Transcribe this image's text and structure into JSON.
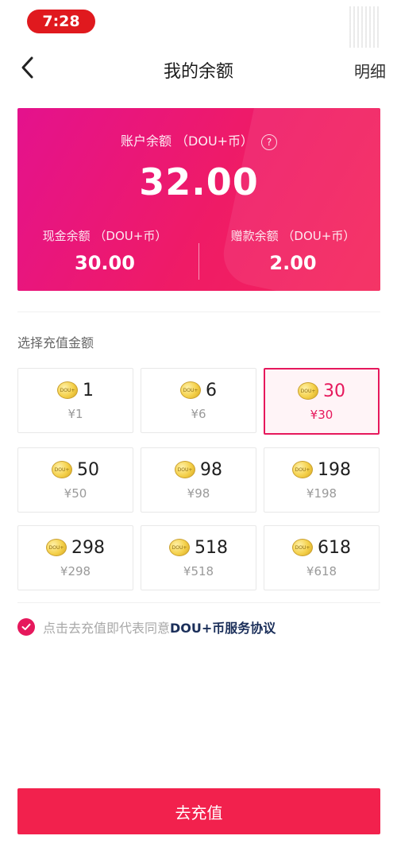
{
  "status_bar": {
    "time": "7:28"
  },
  "nav": {
    "title": "我的余额",
    "detail": "明细"
  },
  "balance": {
    "label": "账户余额 （DOU+币）",
    "total": "32.00",
    "cash_label": "现金余额 （DOU+币）",
    "cash_value": "30.00",
    "gift_label": "赠款余额 （DOU+币）",
    "gift_value": "2.00",
    "help_glyph": "?"
  },
  "section_title": "选择充值金额",
  "coin_text": "DOU+",
  "amounts": [
    {
      "value": "1",
      "price": "¥1",
      "selected": false
    },
    {
      "value": "6",
      "price": "¥6",
      "selected": false
    },
    {
      "value": "30",
      "price": "¥30",
      "selected": true
    },
    {
      "value": "50",
      "price": "¥50",
      "selected": false
    },
    {
      "value": "98",
      "price": "¥98",
      "selected": false
    },
    {
      "value": "198",
      "price": "¥198",
      "selected": false
    },
    {
      "value": "298",
      "price": "¥298",
      "selected": false
    },
    {
      "value": "518",
      "price": "¥518",
      "selected": false
    },
    {
      "value": "618",
      "price": "¥618",
      "selected": false
    }
  ],
  "agreement": {
    "prefix": "点击去充值即代表同意",
    "link": "DOU+币服务协议",
    "checked": true
  },
  "cta_label": "去充值",
  "colors": {
    "accent": "#e6185c",
    "status_pill": "#e0191e",
    "cta": "#f2214d",
    "link": "#1b2f5a"
  }
}
